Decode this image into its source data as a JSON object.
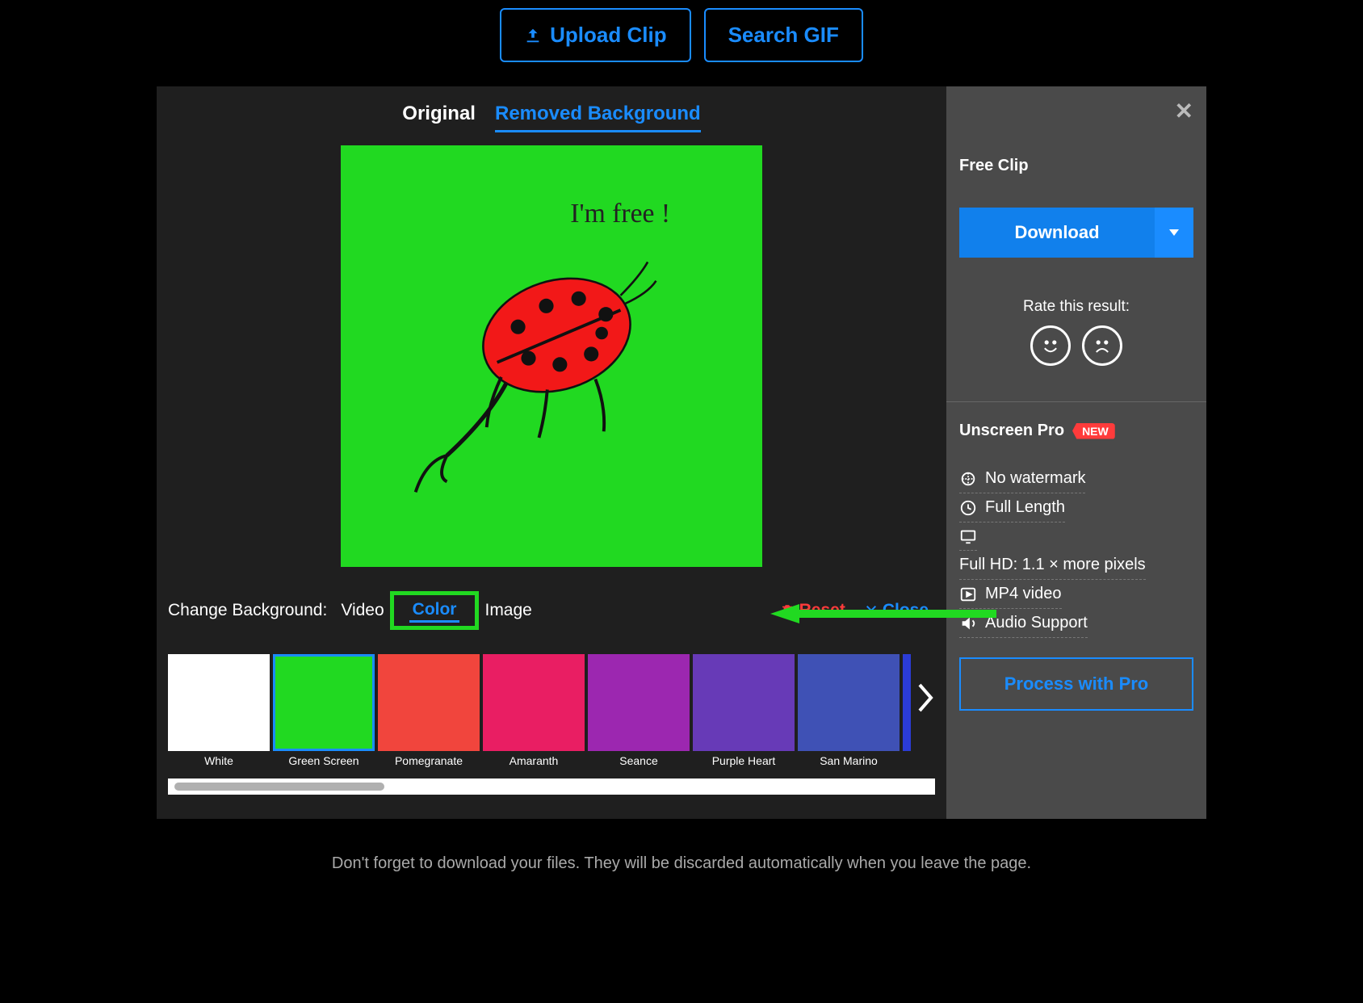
{
  "top": {
    "upload_label": "Upload Clip",
    "search_label": "Search GIF"
  },
  "tabs": {
    "original": "Original",
    "removed": "Removed Background"
  },
  "preview": {
    "caption": "I'm free !"
  },
  "bg": {
    "label": "Change Background:",
    "video": "Video",
    "color": "Color",
    "image": "Image",
    "reset": "Reset",
    "close": "Close"
  },
  "swatches": [
    {
      "name": "White",
      "color": "#ffffff",
      "selected": false
    },
    {
      "name": "Green Screen",
      "color": "#21d921",
      "selected": true
    },
    {
      "name": "Pomegranate",
      "color": "#f1453d",
      "selected": false
    },
    {
      "name": "Amaranth",
      "color": "#e91e63",
      "selected": false
    },
    {
      "name": "Seance",
      "color": "#9c27b0",
      "selected": false
    },
    {
      "name": "Purple Heart",
      "color": "#673ab7",
      "selected": false
    },
    {
      "name": "San Marino",
      "color": "#3f51b5",
      "selected": false
    }
  ],
  "sidebar": {
    "free_clip": "Free Clip",
    "download": "Download",
    "rate": "Rate this result:",
    "pro_title": "Unscreen Pro",
    "new_badge": "NEW",
    "features": {
      "no_watermark": "No watermark",
      "full_length": "Full Length",
      "full_hd": "Full HD: 1.1 × more pixels",
      "mp4": "MP4 video",
      "audio": "Audio Support"
    },
    "process": "Process with Pro"
  },
  "footer": "Don't forget to download your files. They will be discarded automatically when you leave the page."
}
